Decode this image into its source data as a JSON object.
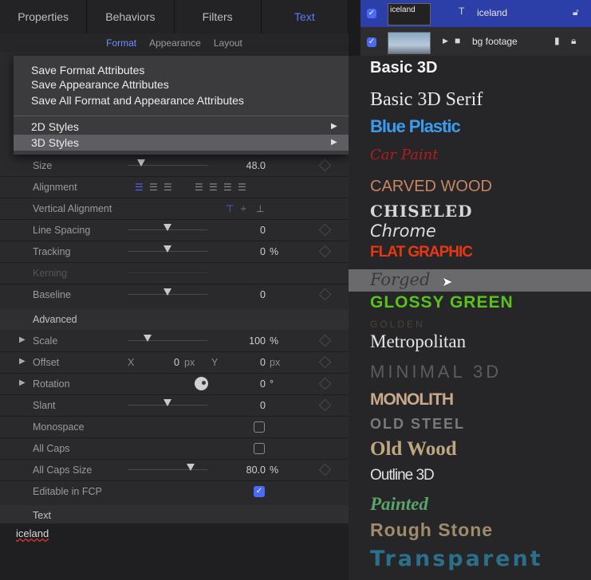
{
  "inspector": {
    "tabs": [
      "Properties",
      "Behaviors",
      "Filters",
      "Text"
    ],
    "active_tab": "Text",
    "subtabs": [
      "Format",
      "Appearance",
      "Layout"
    ],
    "active_subtab": "Format"
  },
  "menu": {
    "save_format": "Save Format Attributes",
    "save_appearance": "Save Appearance Attributes",
    "save_all": "Save All Format and Appearance Attributes",
    "styles_2d": "2D Styles",
    "styles_3d": "3D Styles"
  },
  "params": {
    "size": {
      "label": "Size",
      "value": "48.0"
    },
    "alignment": {
      "label": "Alignment"
    },
    "vertical_alignment": {
      "label": "Vertical Alignment"
    },
    "line_spacing": {
      "label": "Line Spacing",
      "value": "0"
    },
    "tracking": {
      "label": "Tracking",
      "value": "0",
      "unit": "%"
    },
    "kerning": {
      "label": "Kerning"
    },
    "baseline": {
      "label": "Baseline",
      "value": "0"
    }
  },
  "advanced": {
    "title": "Advanced",
    "scale": {
      "label": "Scale",
      "value": "100",
      "unit": "%"
    },
    "offset": {
      "label": "Offset",
      "x_label": "X",
      "x_value": "0",
      "x_unit": "px",
      "y_label": "Y",
      "y_value": "0",
      "y_unit": "px"
    },
    "rotation": {
      "label": "Rotation",
      "value": "0",
      "unit": "°"
    },
    "slant": {
      "label": "Slant",
      "value": "0"
    },
    "monospace": {
      "label": "Monospace",
      "checked": false
    },
    "all_caps": {
      "label": "All Caps",
      "checked": false
    },
    "all_caps_size": {
      "label": "All Caps Size",
      "value": "80.0",
      "unit": "%"
    },
    "editable_fcp": {
      "label": "Editable in FCP",
      "checked": true
    }
  },
  "text_section": {
    "title": "Text",
    "value": "iceland"
  },
  "layers": [
    {
      "thumb_label": "iceland",
      "name": "iceland",
      "selected": true,
      "checked": true
    },
    {
      "thumb_label": "",
      "name": "bg footage",
      "selected": false,
      "checked": true
    }
  ],
  "styles_3d": [
    {
      "name": "Basic 3D",
      "color": "#f2f2f2"
    },
    {
      "name": "Basic 3D Serif",
      "color": "#e8e8e8"
    },
    {
      "name": "Blue Plastic",
      "color": "#3a9cf0"
    },
    {
      "name": "Car Paint",
      "color": "#b51c1c"
    },
    {
      "name": "CARVED WOOD",
      "color": "#c98560"
    },
    {
      "name": "CHISELED",
      "color": "#d6d6d6"
    },
    {
      "name": "Chrome",
      "color": "#dcdcdc"
    },
    {
      "name": "FLAT GRAPHIC",
      "color": "#e8380f"
    },
    {
      "name": "Forged",
      "color": "#3a3a3a"
    },
    {
      "name": "GLOSSY GREEN",
      "color": "#59c21d"
    },
    {
      "name": "GOLDEN",
      "color": "#4a4434"
    },
    {
      "name": "Metropolitan",
      "color": "#e6e6e6"
    },
    {
      "name": "MINIMAL 3D",
      "color": "#5c5c5c"
    },
    {
      "name": "MONOLITH",
      "color": "#c9a98a"
    },
    {
      "name": "OLD STEEL",
      "color": "#7a7a7a"
    },
    {
      "name": "Old Wood",
      "color": "#bfa780"
    },
    {
      "name": "Outline 3D",
      "color": "#e0e0e0"
    },
    {
      "name": "Painted",
      "color": "#5aa56a"
    },
    {
      "name": "Rough Stone",
      "color": "#a08c6a"
    },
    {
      "name": "Transparent",
      "color": "#2c6f8a"
    }
  ],
  "highlighted_style": "Forged",
  "colors": {
    "accent": "#4b6bf7",
    "tab_active": "#5a7cff"
  }
}
